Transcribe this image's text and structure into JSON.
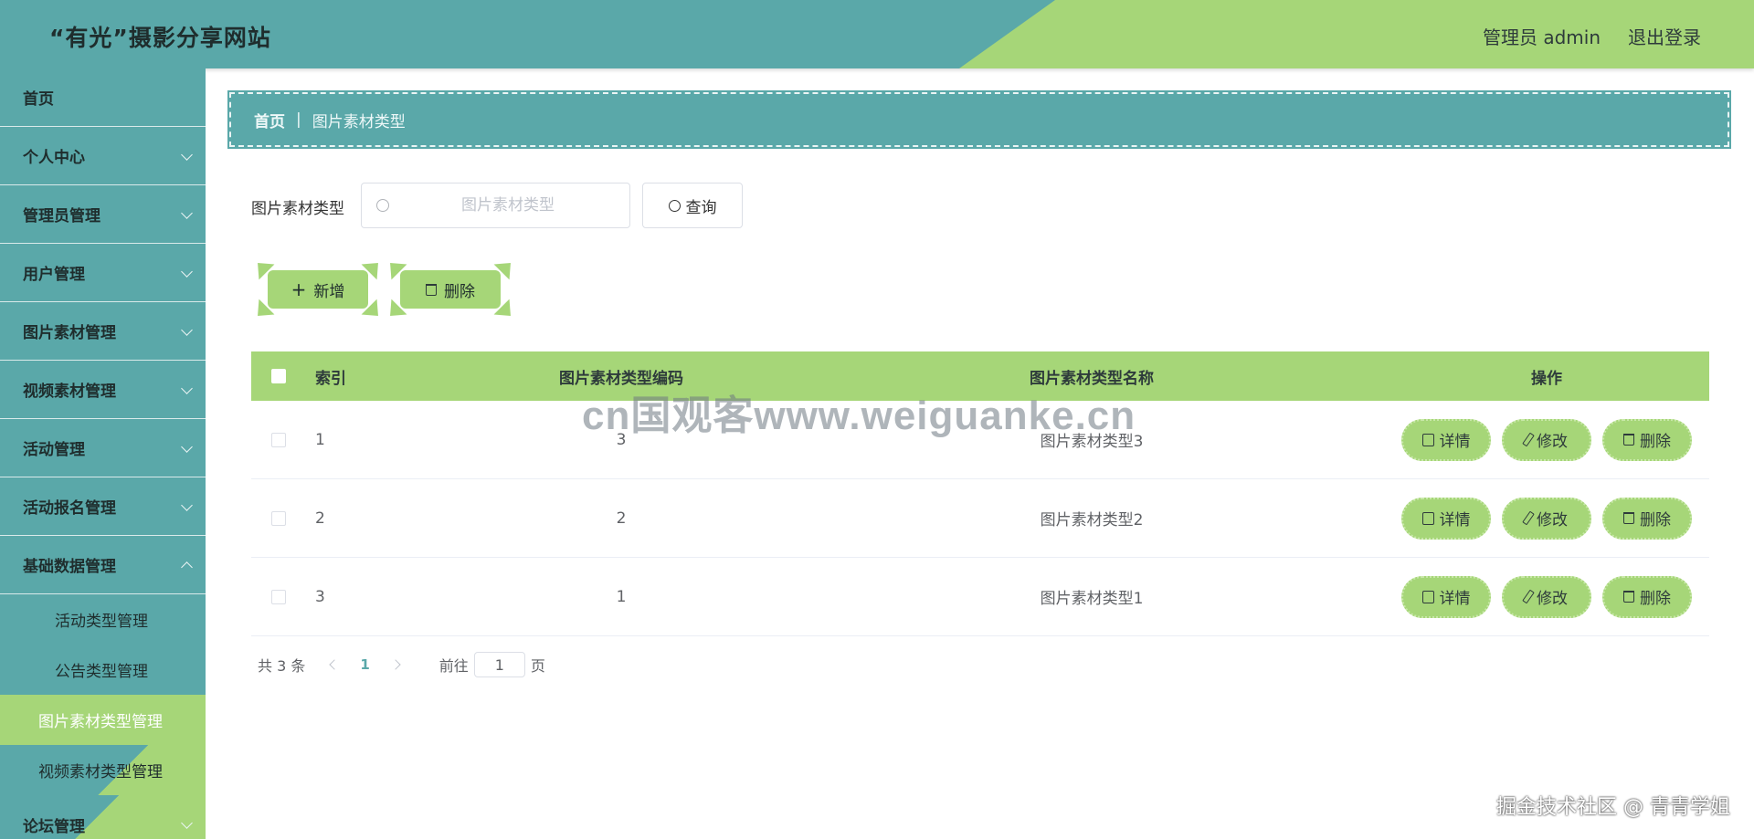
{
  "header": {
    "site_title": "“有光”摄影分享网站",
    "user_label": "管理员 admin",
    "logout_label": "退出登录"
  },
  "sidebar": {
    "items": [
      {
        "label": "首页",
        "has_submenu": false
      },
      {
        "label": "个人中心",
        "has_submenu": true
      },
      {
        "label": "管理员管理",
        "has_submenu": true
      },
      {
        "label": "用户管理",
        "has_submenu": true
      },
      {
        "label": "图片素材管理",
        "has_submenu": true
      },
      {
        "label": "视频素材管理",
        "has_submenu": true
      },
      {
        "label": "活动管理",
        "has_submenu": true
      },
      {
        "label": "活动报名管理",
        "has_submenu": true
      },
      {
        "label": "基础数据管理",
        "has_submenu": true,
        "expanded": true
      },
      {
        "label": "论坛管理",
        "has_submenu": true
      }
    ],
    "sub_items": [
      {
        "label": "活动类型管理"
      },
      {
        "label": "公告类型管理"
      },
      {
        "label": "图片素材类型管理",
        "active": true
      },
      {
        "label": "视频素材类型管理"
      }
    ]
  },
  "breadcrumb": {
    "home": "首页",
    "separator": "|",
    "current": "图片素材类型"
  },
  "search": {
    "label": "图片素材类型",
    "placeholder": "图片素材类型",
    "value": "",
    "query_label": "查询",
    "query_icon": "search-icon"
  },
  "actions": {
    "add_label": "新增",
    "add_icon": "plus-icon",
    "delete_label": "删除",
    "delete_icon": "trash-icon"
  },
  "table": {
    "columns": [
      "索引",
      "图片素材类型编码",
      "图片素材类型名称",
      "操作"
    ],
    "rows": [
      {
        "index": "1",
        "code": "3",
        "name": "图片素材类型3"
      },
      {
        "index": "2",
        "code": "2",
        "name": "图片素材类型2"
      },
      {
        "index": "3",
        "code": "1",
        "name": "图片素材类型1"
      }
    ],
    "row_actions": {
      "detail": "详情",
      "edit": "修改",
      "delete": "删除"
    }
  },
  "pagination": {
    "total_text": "共 3 条",
    "current_page": "1",
    "goto_label": "前往",
    "goto_value": "1",
    "page_suffix": "页"
  },
  "watermark": "cn国观客www.weiguanke.cn",
  "credit": "掘金技术社区 @ 青青学姐",
  "colors": {
    "teal": "#5aa8a9",
    "green": "#a6d678"
  }
}
